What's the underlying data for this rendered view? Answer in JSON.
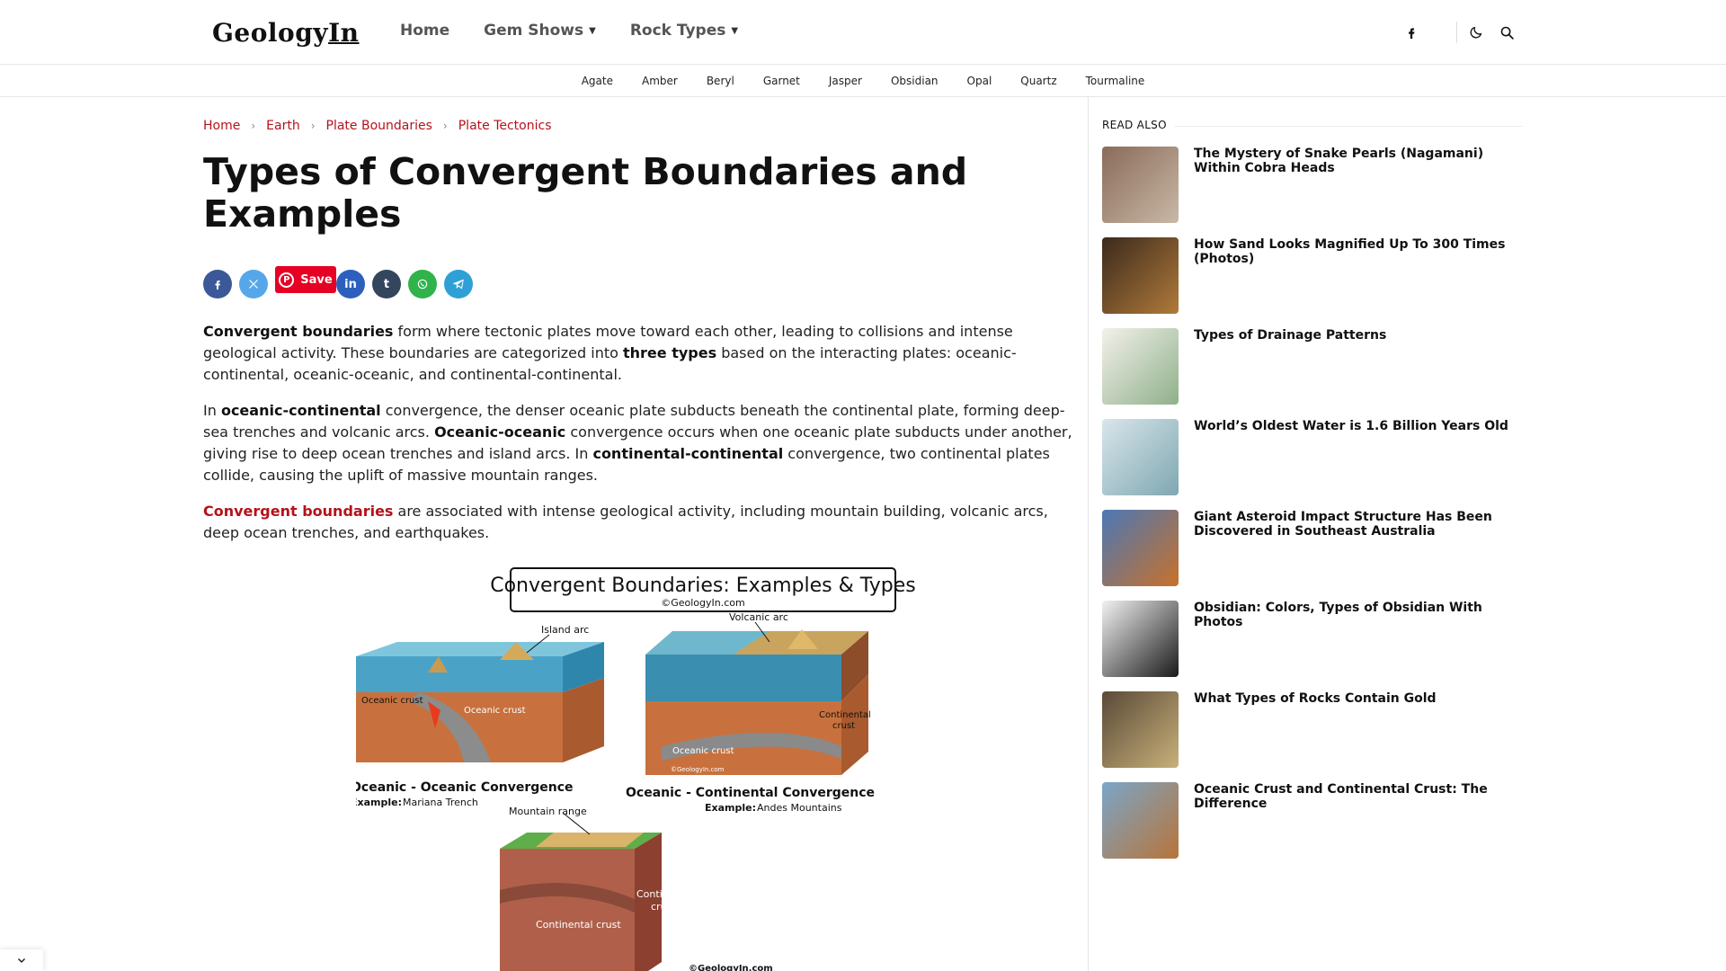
{
  "header": {
    "logo": "Geology",
    "logo_suffix": "In",
    "nav": [
      {
        "label": "Home",
        "has_dropdown": false
      },
      {
        "label": "Gem Shows",
        "has_dropdown": true
      },
      {
        "label": "Rock Types",
        "has_dropdown": true
      }
    ],
    "icons": [
      "facebook-icon",
      "dark-mode-icon",
      "search-icon"
    ]
  },
  "subnav": [
    "Agate",
    "Amber",
    "Beryl",
    "Garnet",
    "Jasper",
    "Obsidian",
    "Opal",
    "Quartz",
    "Tourmaline"
  ],
  "breadcrumb": [
    "Home",
    "Earth",
    "Plate Boundaries",
    "Plate Tectonics"
  ],
  "article": {
    "title": "Types of Convergent Boundaries and Examples",
    "share": {
      "save_label": "Save"
    },
    "p1_a": "Convergent boundaries",
    "p1_b": " form where tectonic plates move toward each other, leading to collisions and intense geological activity. These boundaries are categorized into ",
    "p1_c": "three types",
    "p1_d": " based on the interacting plates: oceanic-continental, oceanic-oceanic, and continental-continental.",
    "p2_a": "In ",
    "p2_b": "oceanic-continental",
    "p2_c": " convergence, the denser oceanic plate subducts beneath the continental plate, forming deep-sea trenches and volcanic arcs. ",
    "p2_d": "Oceanic-oceanic",
    "p2_e": " convergence occurs when one oceanic plate subducts under another, giving rise to deep ocean trenches and island arcs. In ",
    "p2_f": "continental-continental",
    "p2_g": " convergence, two continental plates collide, causing the uplift of massive mountain ranges.",
    "p3_a": "Convergent boundaries",
    "p3_b": " are associated with intense geological activity, including mountain building, volcanic arcs, deep ocean trenches, and earthquakes."
  },
  "figure": {
    "title": "Convergent Boundaries: Examples & Types",
    "credit": "©GeologyIn.com",
    "oo_label": "Oceanic - Oceanic Convergence",
    "oo_example_key": "Example:",
    "oo_example": "Mariana Trench",
    "oo_island_arc": "Island arc",
    "oo_crust1": "Oceanic crust",
    "oo_crust2": "Oceanic crust",
    "oc_label": "Oceanic - Continental Convergence",
    "oc_example_key": "Example:",
    "oc_example": "Andes Mountains",
    "oc_volcanic_arc": "Volcanic arc",
    "oc_crust1": "Oceanic crust",
    "oc_crust2a": "Continental",
    "oc_crust2b": "crust",
    "oc_watermark": "©GeologyIn.com",
    "cc_mountain": "Mountain range",
    "cc_crust1": "Continental crust",
    "cc_crust2a": "Continental",
    "cc_crust2b": "crust",
    "cc_credit": "©GeologyIn.com"
  },
  "sidebar": {
    "heading": "READ ALSO",
    "items": [
      {
        "title": "The Mystery of Snake Pearls (Nagamani) Within Cobra Heads",
        "colors": [
          "#8a6b5a",
          "#c9b8a6"
        ]
      },
      {
        "title": "How Sand Looks Magnified Up To 300 Times (Photos)",
        "colors": [
          "#3b2a1c",
          "#b07a3a"
        ]
      },
      {
        "title": "Types of Drainage Patterns",
        "colors": [
          "#f3f1ea",
          "#8fb08a"
        ]
      },
      {
        "title": "World’s Oldest Water is 1.6 Billion Years Old",
        "colors": [
          "#d8e6ea",
          "#7fa7b2"
        ]
      },
      {
        "title": "Giant Asteroid Impact Structure Has Been Discovered in Southeast Australia",
        "colors": [
          "#4a78b6",
          "#c8712a"
        ]
      },
      {
        "title": "Obsidian: Colors, Types of Obsidian With Photos",
        "colors": [
          "#f2f2f2",
          "#1a1a1a"
        ]
      },
      {
        "title": "What Types of Rocks Contain Gold",
        "colors": [
          "#5a4a38",
          "#c8b07a"
        ]
      },
      {
        "title": "Oceanic Crust and Continental Crust: The Difference",
        "colors": [
          "#7aa6c8",
          "#b8743a"
        ]
      }
    ]
  }
}
